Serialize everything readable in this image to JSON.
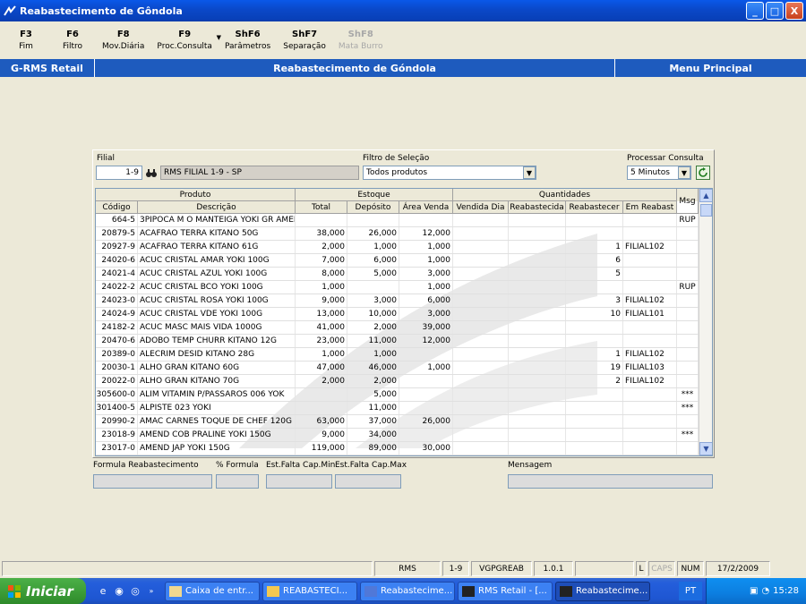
{
  "window": {
    "title": "Reabastecimento de Gôndola",
    "buttons": [
      "_",
      "□",
      "X"
    ]
  },
  "fkeys": [
    {
      "key": "F3",
      "label": "Fim",
      "disabled": false
    },
    {
      "key": "F6",
      "label": "Filtro",
      "disabled": false
    },
    {
      "key": "F8",
      "label": "Mov.Diária",
      "disabled": false
    },
    {
      "key": "F9",
      "label": "Proc.Consulta",
      "disabled": false
    },
    {
      "key": "ShF6",
      "label": "Parâmetros",
      "disabled": false
    },
    {
      "key": "ShF7",
      "label": "Separação",
      "disabled": false
    },
    {
      "key": "ShF8",
      "label": "Mata Burro",
      "disabled": true
    }
  ],
  "band": {
    "left": "G-RMS Retail",
    "center": "Reabastecimento de Góndola",
    "right": "Menu Principal"
  },
  "filter": {
    "filial_label": "Filial",
    "filial_code": "1-9",
    "filial_name": "RMS FILIAL 1-9 - SP",
    "selecao_label": "Filtro de Seleção",
    "selecao_value": "Todos produtos",
    "processar_label": "Processar Consulta",
    "processar_value": "5 Minutos"
  },
  "grid": {
    "groups": [
      "Produto",
      "Estoque",
      "Quantidades",
      "Msg"
    ],
    "columns": [
      "Código",
      "Descrição",
      "Total",
      "Depósito",
      "Área Venda",
      "Vendida Dia",
      "Reabastecida",
      "Reabastecer",
      "Em Reabast"
    ],
    "rows": [
      [
        "664-5",
        "3PIPOCA M O MANTEIGA YOKI GR AMEI",
        "",
        "",
        "",
        "",
        "",
        "",
        "",
        "RUP"
      ],
      [
        "20879-5",
        "ACAFRAO TERRA KITANO 50G",
        "38,000",
        "26,000",
        "12,000",
        "",
        "",
        "",
        "",
        ""
      ],
      [
        "20927-9",
        "ACAFRAO TERRA KITANO 61G",
        "2,000",
        "1,000",
        "1,000",
        "",
        "",
        "1",
        "FILIAL102",
        ""
      ],
      [
        "24020-6",
        "ACUC CRISTAL AMAR YOKI 100G",
        "7,000",
        "6,000",
        "1,000",
        "",
        "",
        "6",
        "",
        ""
      ],
      [
        "24021-4",
        "ACUC CRISTAL AZUL YOKI 100G",
        "8,000",
        "5,000",
        "3,000",
        "",
        "",
        "5",
        "",
        ""
      ],
      [
        "24022-2",
        "ACUC CRISTAL BCO YOKI 100G",
        "1,000",
        "",
        "1,000",
        "",
        "",
        "",
        "",
        "RUP"
      ],
      [
        "24023-0",
        "ACUC CRISTAL ROSA YOKI 100G",
        "9,000",
        "3,000",
        "6,000",
        "",
        "",
        "3",
        "FILIAL102",
        ""
      ],
      [
        "24024-9",
        "ACUC CRISTAL VDE YOKI 100G",
        "13,000",
        "10,000",
        "3,000",
        "",
        "",
        "10",
        "FILIAL101",
        ""
      ],
      [
        "24182-2",
        "ACUC MASC MAIS VIDA 1000G",
        "41,000",
        "2,000",
        "39,000",
        "",
        "",
        "",
        "",
        ""
      ],
      [
        "20470-6",
        "ADOBO TEMP CHURR KITANO 12G",
        "23,000",
        "11,000",
        "12,000",
        "",
        "",
        "",
        "",
        ""
      ],
      [
        "20389-0",
        "ALECRIM DESID KITANO 28G",
        "1,000",
        "1,000",
        "",
        "",
        "",
        "1",
        "FILIAL102",
        ""
      ],
      [
        "20030-1",
        "ALHO GRAN KITANO 60G",
        "47,000",
        "46,000",
        "1,000",
        "",
        "",
        "19",
        "FILIAL103",
        ""
      ],
      [
        "20022-0",
        "ALHO GRAN KITANO 70G",
        "2,000",
        "2,000",
        "",
        "",
        "",
        "2",
        "FILIAL102",
        ""
      ],
      [
        "305600-0",
        "ALIM VITAMIN P/PASSAROS 006 YOK",
        "",
        "5,000",
        "",
        "",
        "",
        "",
        "",
        "***"
      ],
      [
        "301400-5",
        "ALPISTE 023 YOKI",
        "",
        "11,000",
        "",
        "",
        "",
        "",
        "",
        "***"
      ],
      [
        "20990-2",
        "AMAC CARNES TOQUE DE CHEF 120G",
        "63,000",
        "37,000",
        "26,000",
        "",
        "",
        "",
        "",
        ""
      ],
      [
        "23018-9",
        "AMEND COB PRALINE YOKI 150G",
        "9,000",
        "34,000",
        "",
        "",
        "",
        "",
        "",
        "***"
      ],
      [
        "23017-0",
        "AMEND JAP YOKI 150G",
        "119,000",
        "89,000",
        "30,000",
        "",
        "",
        "",
        "",
        ""
      ]
    ]
  },
  "bottom": {
    "formula_label": "Formula Reabastecimento",
    "pct_label": "% Formula",
    "min_label": "Est.Falta Cap.Min",
    "max_label": "Est.Falta Cap.Max",
    "msg_label": "Mensagem"
  },
  "status": {
    "cells": [
      "RMS",
      "1-9",
      "VGPGREAB",
      "1.0.1"
    ],
    "l": "L",
    "caps": "CAPS",
    "num": "NUM",
    "date": "17/2/2009"
  },
  "taskbar": {
    "start": "Iniciar",
    "tasks": [
      "Caixa de entr...",
      "REABASTECI...",
      "Reabastecime...",
      "RMS Retail - [...",
      "Reabastecime..."
    ],
    "lang": "PT",
    "clock": "15:28"
  },
  "colors": {
    "accent": "#1E5BBE",
    "title": "#0A48C8",
    "taskbar": "#245EDB"
  }
}
